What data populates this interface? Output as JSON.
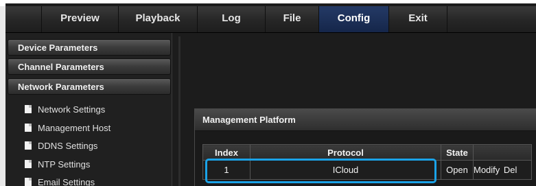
{
  "nav": {
    "items": [
      {
        "label": "Preview"
      },
      {
        "label": "Playback"
      },
      {
        "label": "Log"
      },
      {
        "label": "File"
      },
      {
        "label": "Config"
      },
      {
        "label": "Exit"
      }
    ],
    "active": "Config"
  },
  "sidebar": {
    "sections": [
      {
        "label": "Device Parameters"
      },
      {
        "label": "Channel Parameters"
      },
      {
        "label": "Network Parameters"
      }
    ],
    "items": [
      {
        "label": "Network Settings"
      },
      {
        "label": "Management Host"
      },
      {
        "label": "DDNS Settings"
      },
      {
        "label": "NTP Settings"
      },
      {
        "label": "Email Settings"
      }
    ]
  },
  "panel": {
    "title": "Management Platform",
    "table": {
      "headers": {
        "index": "Index",
        "protocol": "Protocol",
        "state": "State"
      },
      "rows": [
        {
          "index": "1",
          "protocol": "ICloud",
          "state": "Open",
          "modify": "Modify",
          "del": "Del"
        }
      ]
    }
  },
  "colors": {
    "highlight": "#1aa3e8",
    "active_tab": "#1b2f58"
  }
}
